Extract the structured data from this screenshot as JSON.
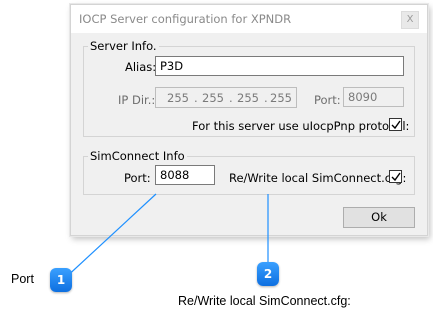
{
  "dialog": {
    "title": "IOCP Server configuration for XPNDR",
    "close_glyph": "X",
    "server_info": {
      "legend": "Server Info.",
      "alias_label": "Alias:",
      "alias_value": "P3D",
      "ip_label": "IP Dir.:",
      "ip_segments": [
        "255",
        "255",
        "255",
        "255"
      ],
      "port_label": "Port:",
      "port_value": "8090",
      "protocol_label": "For this server use uIocpPnp protocol:",
      "protocol_checked": true
    },
    "simconnect_info": {
      "legend": "SimConnect Info",
      "port_label": "Port:",
      "port_value": "8088",
      "rewrite_label": "Re/Write local SimConnect.cfg:",
      "rewrite_checked": true
    },
    "ok_label": "Ok"
  },
  "callouts": [
    {
      "number": "1",
      "label": "Port"
    },
    {
      "number": "2",
      "label": "Re/Write local SimConnect.cfg:"
    }
  ],
  "colors": {
    "badge": "#1e90ff",
    "callout_line": "#1e90ff"
  }
}
